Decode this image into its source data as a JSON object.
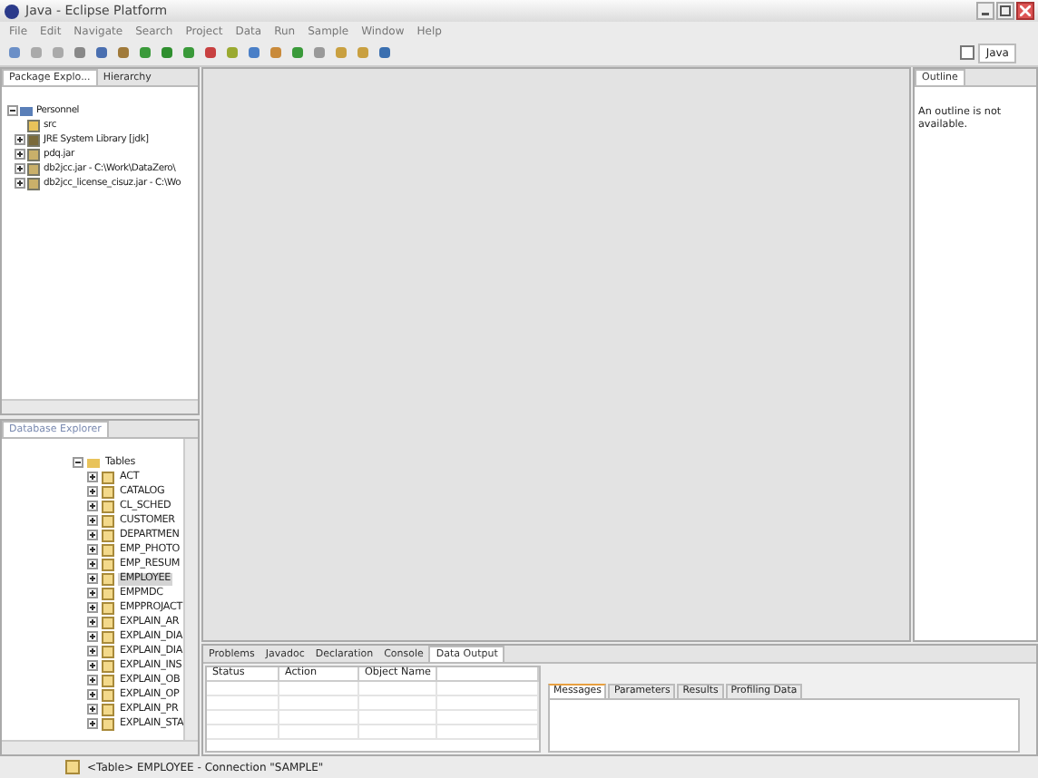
{
  "window": {
    "title": "Java - Eclipse Platform"
  },
  "menu": [
    "File",
    "Edit",
    "Navigate",
    "Search",
    "Project",
    "Data",
    "Run",
    "Sample",
    "Window",
    "Help"
  ],
  "perspective": {
    "label": "Java",
    "selected": true
  },
  "package_explorer": {
    "tabs": [
      {
        "label": "Package Explo...",
        "selected": true
      },
      {
        "label": "Hierarchy",
        "selected": false
      }
    ],
    "tree": [
      {
        "label": "Personnel",
        "kind": "project",
        "expanded": true,
        "children": [
          {
            "label": "src",
            "kind": "folder"
          },
          {
            "label": "JRE System Library [jdk]",
            "kind": "library",
            "expanded": false
          },
          {
            "label": "pdq.jar",
            "kind": "jar",
            "expanded": false
          },
          {
            "label": "db2jcc.jar - C:\\Work\\DataZero\\",
            "kind": "jar",
            "expanded": false
          },
          {
            "label": "db2jcc_license_cisuz.jar - C:\\Wo",
            "kind": "jar",
            "expanded": false
          }
        ]
      }
    ]
  },
  "database_explorer": {
    "title": "Database Explorer",
    "tree": [
      {
        "label": "Tables",
        "kind": "folder",
        "expanded": true,
        "children": [
          {
            "label": "ACT",
            "selected": false
          },
          {
            "label": "CATALOG",
            "selected": false
          },
          {
            "label": "CL_SCHED",
            "selected": false
          },
          {
            "label": "CUSTOMER",
            "selected": false
          },
          {
            "label": "DEPARTMEN",
            "selected": false
          },
          {
            "label": "EMP_PHOTO",
            "selected": false
          },
          {
            "label": "EMP_RESUM",
            "selected": false
          },
          {
            "label": "EMPLOYEE",
            "selected": true
          },
          {
            "label": "EMPMDC",
            "selected": false
          },
          {
            "label": "EMPPROJACT",
            "selected": false
          },
          {
            "label": "EXPLAIN_AR",
            "selected": false
          },
          {
            "label": "EXPLAIN_DIA",
            "selected": false
          },
          {
            "label": "EXPLAIN_DIA",
            "selected": false
          },
          {
            "label": "EXPLAIN_INS",
            "selected": false
          },
          {
            "label": "EXPLAIN_OB",
            "selected": false
          },
          {
            "label": "EXPLAIN_OP",
            "selected": false
          },
          {
            "label": "EXPLAIN_PR",
            "selected": false
          },
          {
            "label": "EXPLAIN_STA",
            "selected": false
          }
        ]
      }
    ]
  },
  "outline": {
    "title": "Outline",
    "message": "An outline is not available."
  },
  "bottom_panel": {
    "tabs": [
      {
        "label": "Problems",
        "selected": false
      },
      {
        "label": "Javadoc",
        "selected": false
      },
      {
        "label": "Declaration",
        "selected": false
      },
      {
        "label": "Console",
        "selected": false
      },
      {
        "label": "Data Output",
        "selected": true
      }
    ],
    "table": {
      "columns": [
        "Status",
        "Action",
        "Object Name"
      ]
    },
    "detail_tabs": [
      {
        "label": "Messages",
        "selected": true
      },
      {
        "label": "Parameters",
        "selected": false
      },
      {
        "label": "Results",
        "selected": false
      },
      {
        "label": "Profiling Data",
        "selected": false
      }
    ]
  },
  "status_bar": {
    "text": "<Table> EMPLOYEE - Connection \"SAMPLE\""
  }
}
